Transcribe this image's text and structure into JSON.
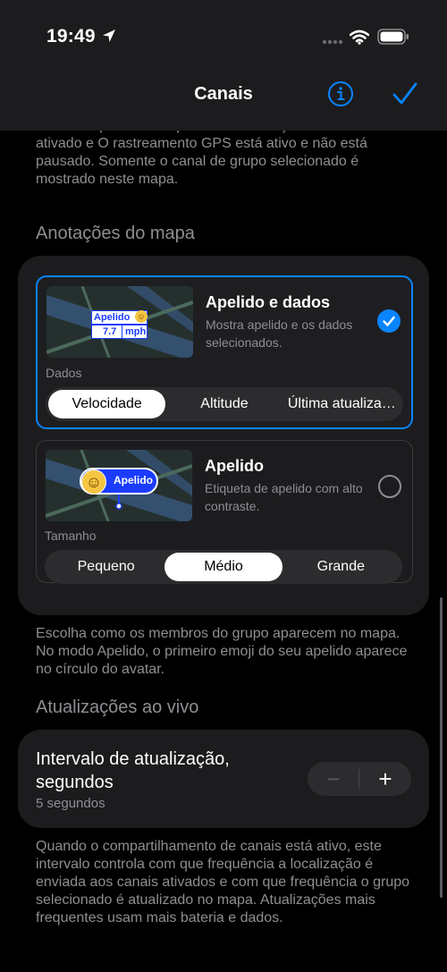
{
  "status": {
    "time": "19:49"
  },
  "nav": {
    "title": "Canais"
  },
  "intro_text": "somente quando Compartilhar localização com canais está ativado e O rastreamento GPS está ativo e não está pausado. Somente o canal de grupo selecionado é mostrado neste mapa.",
  "annotations": {
    "header": "Anotações do mapa",
    "option1": {
      "title": "Apelido e dados",
      "description": "Mostra apelido e os dados selecionados.",
      "preview_name": "Apelido",
      "preview_speed": "7.7",
      "preview_unit": "mph",
      "field_label": "Dados",
      "segments": [
        "Velocidade",
        "Altitude",
        "Última atualiza…"
      ],
      "selected_segment": "Velocidade"
    },
    "option2": {
      "title": "Apelido",
      "description": "Etiqueta de apelido com alto contraste.",
      "preview_name": "Apelido",
      "field_label": "Tamanho",
      "segments": [
        "Pequeno",
        "Médio",
        "Grande"
      ],
      "selected_segment": "Médio"
    },
    "footer": "Escolha como os membros do grupo aparecem no mapa. No modo Apelido, o primeiro emoji do seu apelido aparece no círculo do avatar."
  },
  "live": {
    "header": "Atualizações ao vivo",
    "interval_title": "Intervalo de atualização, segundos",
    "interval_value": "5 segundos",
    "minus": "−",
    "plus": "+",
    "footer": "Quando o compartilhamento de canais está ativo, este intervalo controla com que frequência a localização é enviada aos canais ativados e com que frequência o grupo selecionado é atualizado no mapa. Atualizações mais frequentes usam mais bateria e dados."
  },
  "colors": {
    "accent": "#0a84ff",
    "card": "#1c1c1e",
    "secondary_text": "#8e8e93"
  },
  "icons": {
    "info": "info-circle-icon",
    "done": "checkmark-icon",
    "selected": "checkmark-circle-icon"
  }
}
